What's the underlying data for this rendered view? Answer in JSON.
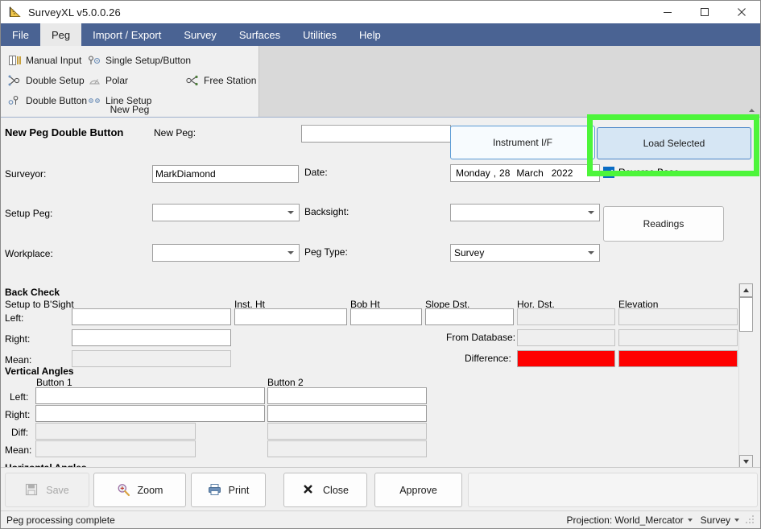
{
  "window": {
    "title": "SurveyXL v5.0.0.26",
    "icon": "surveyxl-triangle-icon",
    "controls": {
      "minimize": "minimize-icon",
      "maximize": "maximize-icon",
      "close": "close-icon"
    }
  },
  "menu": {
    "items": [
      {
        "label": "File",
        "active": false
      },
      {
        "label": "Peg",
        "active": true
      },
      {
        "label": "Import / Export",
        "active": false
      },
      {
        "label": "Survey",
        "active": false
      },
      {
        "label": "Surfaces",
        "active": false
      },
      {
        "label": "Utilities",
        "active": false
      },
      {
        "label": "Help",
        "active": false
      }
    ]
  },
  "ribbon": {
    "group_label": "New Peg",
    "buttons": [
      {
        "label": "Manual Input",
        "icon": "manual-input-icon"
      },
      {
        "label": "Single Setup/Button",
        "icon": "single-setup-icon"
      },
      {
        "label": "Double Setup",
        "icon": "double-setup-icon"
      },
      {
        "label": "Polar",
        "icon": "polar-icon"
      },
      {
        "label": "Free Station",
        "icon": "free-station-icon"
      },
      {
        "label": "Double Button",
        "icon": "double-button-icon"
      },
      {
        "label": "Line Setup",
        "icon": "line-setup-icon"
      }
    ]
  },
  "form": {
    "heading": "New Peg Double Button",
    "labels": {
      "new_peg": "New Peg:",
      "surveyor": "Surveyor:",
      "date": "Date:",
      "setup_peg": "Setup Peg:",
      "backsight": "Backsight:",
      "workplace": "Workplace:",
      "peg_type": "Peg Type:"
    },
    "values": {
      "new_peg": "",
      "surveyor": "MarkDiamond",
      "setup_peg": "",
      "backsight": "",
      "workplace": "",
      "peg_type": "Survey"
    },
    "date": {
      "day_name": "Monday",
      "comma": ",",
      "day": "28",
      "month": "March",
      "year": "2022"
    },
    "buttons": {
      "instrument_if": "Instrument I/F",
      "load_selected": "Load Selected",
      "readings": "Readings"
    },
    "reverse_base": {
      "label": "Reverse Base",
      "checked": true
    }
  },
  "back_check": {
    "title": "Back Check",
    "headers": {
      "setup_to_bsight": "Setup to B'Sight",
      "inst_ht": "Inst. Ht",
      "bob_ht": "Bob Ht",
      "slope_dst": "Slope Dst.",
      "hor_dst": "Hor. Dst.",
      "elevation": "Elevation"
    },
    "rows": {
      "left": "Left:",
      "right": "Right:",
      "mean": "Mean:",
      "from_database": "From Database:",
      "difference": "Difference:"
    },
    "values": {
      "left_bsight": "",
      "left_inst_ht": "",
      "left_bob_ht": "",
      "left_slope": "",
      "left_hor": "",
      "left_elev": "",
      "right_bsight": "",
      "mean_bsight": "",
      "db_hor": "",
      "db_elev": "",
      "diff_hor": "",
      "diff_elev": ""
    },
    "difference_color": "#fe0000"
  },
  "vertical_angles": {
    "title": "Vertical Angles",
    "columns": [
      "Button 1",
      "Button 2"
    ],
    "rows": [
      "Left:",
      "Right:",
      "Diff:",
      "Mean:"
    ],
    "values": {
      "b1_left": "",
      "b2_left": "",
      "b1_right": "",
      "b2_right": "",
      "b1_diff": "",
      "b2_diff": "",
      "b1_mean": "",
      "b2_mean": ""
    }
  },
  "horizontal_angles": {
    "title": "Horizontal Angles"
  },
  "bottom_toolbar": {
    "buttons": [
      {
        "label": "Save",
        "icon": "save-disk-icon",
        "disabled": true
      },
      {
        "label": "Zoom",
        "icon": "magnifier-plus-icon",
        "disabled": false
      },
      {
        "label": "Print",
        "icon": "printer-icon",
        "disabled": false
      },
      {
        "label": "Close",
        "icon": "x-cross-icon",
        "disabled": false
      },
      {
        "label": "Approve",
        "icon": "",
        "disabled": false
      }
    ]
  },
  "statusbar": {
    "message": "Peg processing complete",
    "projection": "Projection: World_Mercator",
    "mode": "Survey"
  },
  "annotation": {
    "highlight_color": "#4df53a",
    "target": "load-selected-button"
  }
}
